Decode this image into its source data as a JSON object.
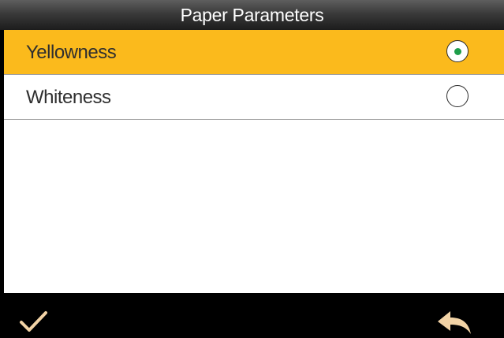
{
  "header": {
    "title": "Paper Parameters"
  },
  "options": [
    {
      "label": "Yellowness",
      "selected": true
    },
    {
      "label": "Whiteness",
      "selected": false
    }
  ],
  "footer": {
    "confirm_icon": "checkmark-icon",
    "back_icon": "return-arrow-icon"
  },
  "colors": {
    "selected_row": "#fbba1c",
    "radio_dot": "#1e9e4a",
    "footer_icon": "#f2d3a6"
  }
}
